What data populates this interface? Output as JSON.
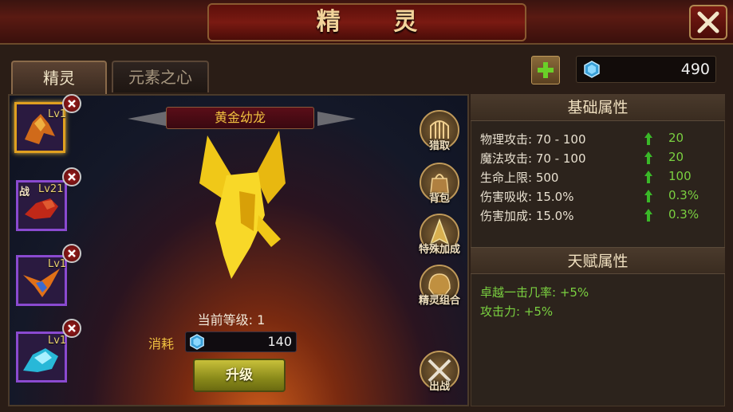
{
  "title": "精 灵",
  "tabs": [
    "精灵",
    "元素之心"
  ],
  "currency": {
    "value": "490"
  },
  "sprites": [
    {
      "level": "Lv1",
      "selected": true,
      "badge": ""
    },
    {
      "level": "Lv21",
      "selected": false,
      "badge": "战"
    },
    {
      "level": "Lv1",
      "selected": false,
      "badge": ""
    },
    {
      "level": "Lv1",
      "selected": false,
      "badge": ""
    }
  ],
  "sprite_name": "黄金幼龙",
  "side_buttons": [
    "猎取",
    "背包",
    "特殊加成",
    "精灵组合",
    "出战"
  ],
  "current_level": "当前等级: 1",
  "cost": {
    "label": "消耗",
    "value": "140"
  },
  "upgrade_label": "升级",
  "base_attr": {
    "header": "基础属性",
    "rows": [
      {
        "name": "物理攻击: 70 - 100",
        "inc": "20"
      },
      {
        "name": "魔法攻击: 70 - 100",
        "inc": "20"
      },
      {
        "name": "生命上限: 500",
        "inc": "100"
      },
      {
        "name": "伤害吸收: 15.0%",
        "inc": "0.3%"
      },
      {
        "name": "伤害加成: 15.0%",
        "inc": "0.3%"
      }
    ]
  },
  "talent_attr": {
    "header": "天赋属性",
    "rows": [
      "卓越一击几率: +5%",
      "攻击力: +5%"
    ]
  },
  "colors": {
    "accent_gold": "#f0c040",
    "stat_green": "#7ad040",
    "title_red": "#7a1a12"
  }
}
